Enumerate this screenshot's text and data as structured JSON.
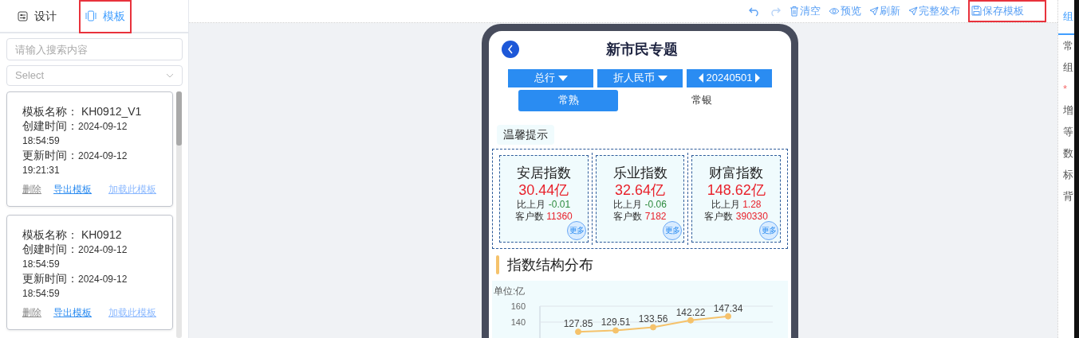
{
  "sidebar": {
    "tabs": [
      {
        "label": "设计",
        "selected": false,
        "highlighted": false
      },
      {
        "label": "模板",
        "selected": true,
        "highlighted": true
      }
    ],
    "search": {
      "placeholder": "请输入搜索内容"
    },
    "select": {
      "placeholder": "Select"
    },
    "templates": [
      {
        "name_label": "模板名称：",
        "name": "KH0912_V1",
        "created_label": "创建时间：",
        "created": "2024-09-12 18:54:59",
        "updated_label": "更新时间：",
        "updated": "2024-09-12 19:21:31",
        "actions": [
          "删除",
          "导出模板",
          "加载此模板"
        ]
      },
      {
        "name_label": "模板名称：",
        "name": "KH0912",
        "created_label": "创建时间：",
        "created": "2024-09-12 18:54:59",
        "updated_label": "更新时间：",
        "updated": "2024-09-12 18:54:59",
        "actions": [
          "删除",
          "导出模板",
          "加载此模板"
        ]
      }
    ]
  },
  "toolbar": [
    {
      "kind": "undo",
      "disabled": false,
      "highlighted": false
    },
    {
      "kind": "redo",
      "disabled": true,
      "highlighted": false
    },
    {
      "kind": "trash",
      "label": "清空",
      "disabled": false,
      "highlighted": false
    },
    {
      "kind": "eye",
      "label": "预览",
      "disabled": false,
      "highlighted": false
    },
    {
      "kind": "send",
      "label": "刷新",
      "disabled": false,
      "highlighted": false
    },
    {
      "kind": "send",
      "label": "完整发布",
      "disabled": false,
      "highlighted": false
    },
    {
      "kind": "save",
      "label": "保存模板",
      "disabled": false,
      "highlighted": true
    }
  ],
  "phone": {
    "title": "新市民专题",
    "filters": [
      {
        "kind": "dropdown",
        "label": "总行"
      },
      {
        "kind": "dropdown",
        "label": "折人民币"
      },
      {
        "kind": "stepper",
        "label": "20240501"
      }
    ],
    "tabs": [
      {
        "label": "常熟",
        "selected": true
      },
      {
        "label": "常银",
        "selected": false
      }
    ],
    "notice": "温馨提示",
    "indices": [
      {
        "name": "安居指数",
        "value": "30.44亿",
        "change_label": "比上月",
        "change": "-0.01",
        "color": "#2e8b3e",
        "customers_label": "客户数",
        "customers": "11360",
        "more": "更多"
      },
      {
        "name": "乐业指数",
        "value": "32.64亿",
        "change_label": "比上月",
        "change": "-0.06",
        "color": "#2e8b3e",
        "customers_label": "客户数",
        "customers": "7182",
        "more": "更多"
      },
      {
        "name": "财富指数",
        "value": "148.62亿",
        "change_label": "比上月",
        "change": "1.28",
        "color": "#e8222c",
        "customers_label": "客户数",
        "customers": "390330",
        "more": "更多"
      }
    ],
    "section_title": "指数结构分布",
    "chart_unit": "单位:亿",
    "chart_data": {
      "type": "line",
      "ylim": [
        120,
        160
      ],
      "yticks": [
        140,
        160
      ],
      "data_labels": true,
      "series": [
        {
          "color": "#f5c26b",
          "marker": "circle",
          "values": [
            127.85,
            129.51,
            133.56,
            142.22,
            147.34
          ]
        }
      ]
    }
  },
  "right_panel": {
    "tab": "组",
    "rows": [
      "常",
      "组",
      "*",
      "增",
      "等",
      "数",
      "标",
      "背"
    ]
  }
}
